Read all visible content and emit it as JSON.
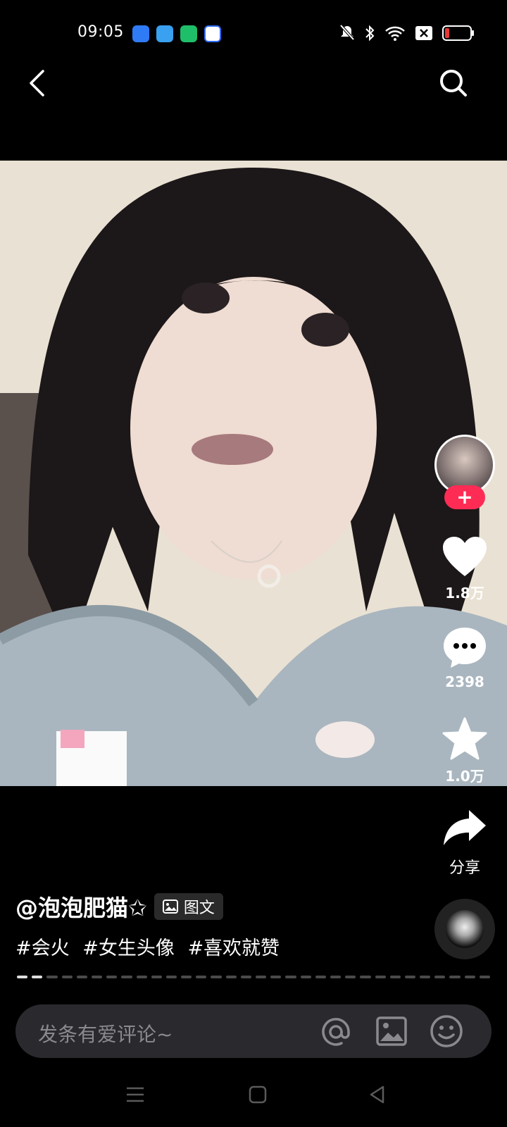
{
  "status_bar": {
    "time": "09:05",
    "app_icons": [
      "messages-app-icon",
      "weather-app-icon",
      "battery-saver-app-icon",
      "baidu-app-icon"
    ],
    "indicators": [
      "mute-icon",
      "bluetooth-icon",
      "wifi-icon",
      "sim-icon",
      "battery-icon"
    ]
  },
  "nav": {
    "back_icon": "chevron-left-icon",
    "search_icon": "search-icon"
  },
  "actions": {
    "like_count": "1.8万",
    "comment_count": "2398",
    "favorite_count": "1.0万",
    "share_label": "分享"
  },
  "post": {
    "author": "@泡泡肥猫✩",
    "type_label": "图文",
    "tags": [
      "#会火",
      "#女生头像",
      "#喜欢就赞"
    ]
  },
  "slides": {
    "total": 32,
    "current_index": 2
  },
  "comment_bar": {
    "placeholder": "发条有爱评论~"
  },
  "colors": {
    "accent": "#fe2c55",
    "background": "#000000",
    "comment_bar": "#2a2a2e"
  }
}
